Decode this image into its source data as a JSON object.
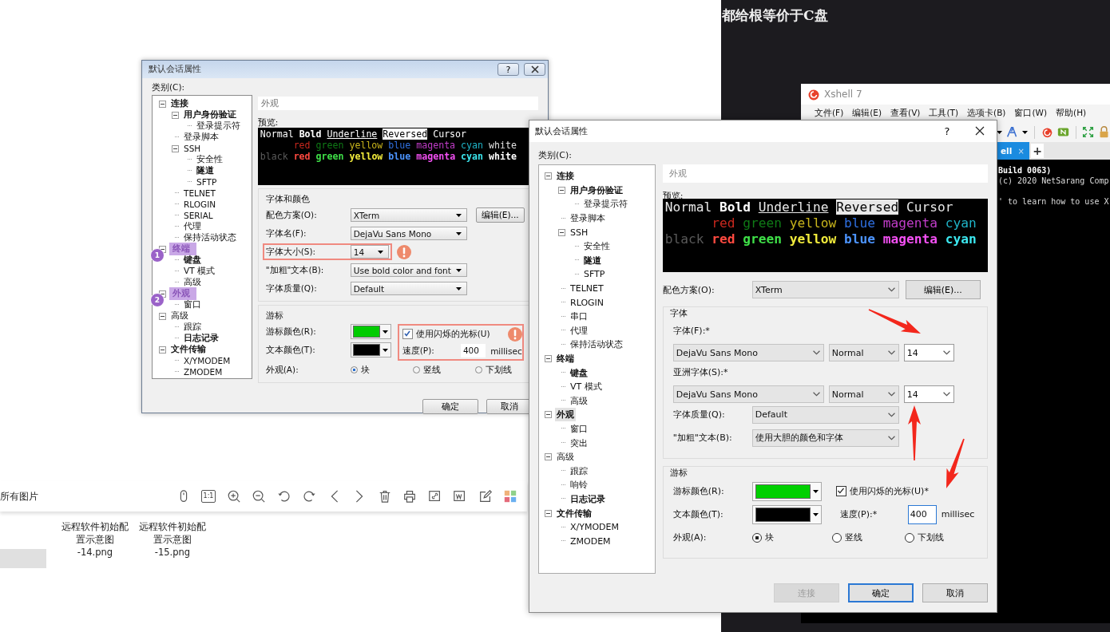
{
  "background": {
    "heading": "都给根等价于C盘"
  },
  "image_viewer": {
    "toolbar_label": "所有图片",
    "ratio_button": "1:1",
    "files": [
      {
        "name": "远程软件初始配置示意图",
        "suffix": "-14.png"
      },
      {
        "name": "远程软件初始配置示意图",
        "suffix": "-15.png"
      }
    ]
  },
  "old_dialog": {
    "title": "默认会话属性",
    "help": "?",
    "category_label": "类别(C):",
    "tree": [
      {
        "label": "连接",
        "bold": true,
        "expanded": true,
        "children": [
          {
            "label": "用户身份验证",
            "bold": true,
            "expanded": true,
            "children": [
              {
                "label": "登录提示符",
                "bold": false
              }
            ]
          },
          {
            "label": "登录脚本",
            "bold": false
          },
          {
            "label": "SSH",
            "bold": false,
            "expanded": true,
            "children": [
              {
                "label": "安全性",
                "bold": false
              },
              {
                "label": "隧道",
                "bold": true
              },
              {
                "label": "SFTP",
                "bold": false
              }
            ]
          },
          {
            "label": "TELNET",
            "bold": false
          },
          {
            "label": "RLOGIN",
            "bold": false
          },
          {
            "label": "SERIAL",
            "bold": false
          },
          {
            "label": "代理",
            "bold": false
          },
          {
            "label": "保持活动状态",
            "bold": false
          }
        ]
      },
      {
        "label": "终端",
        "bold": true,
        "badge": "1",
        "expanded": true,
        "children": [
          {
            "label": "键盘",
            "bold": true
          },
          {
            "label": "VT 模式",
            "bold": false
          },
          {
            "label": "高级",
            "bold": false
          }
        ]
      },
      {
        "label": "外观",
        "bold": true,
        "badge": "2",
        "expanded": true,
        "children": [
          {
            "label": "窗口",
            "bold": false
          }
        ]
      },
      {
        "label": "高级",
        "bold": false,
        "expanded": true,
        "children": [
          {
            "label": "跟踪",
            "bold": false
          },
          {
            "label": "日志记录",
            "bold": true
          }
        ]
      },
      {
        "label": "文件传输",
        "bold": true,
        "expanded": true,
        "children": [
          {
            "label": "X/YMODEM",
            "bold": false
          },
          {
            "label": "ZMODEM",
            "bold": false
          }
        ]
      }
    ],
    "page_title": "外观",
    "preview_label": "预览:",
    "preview": [
      {
        "indent": false,
        "segments": [
          {
            "text": "Normal",
            "kind": "normal",
            "color": "#ffffff"
          },
          {
            "text": "Bold",
            "kind": "bold",
            "color": "#ffffff"
          },
          {
            "text": "Underline",
            "kind": "underline",
            "color": "#ffffff"
          },
          {
            "text": "Reversed",
            "kind": "reversed",
            "color": "#ffffff"
          },
          {
            "text": "Cursor",
            "kind": "normal",
            "color": "#ffffff"
          }
        ]
      },
      {
        "indent": true,
        "segments": [
          {
            "text": "red",
            "kind": "normal",
            "color": "#c8281e"
          },
          {
            "text": "green",
            "kind": "normal",
            "color": "#0f7a16"
          },
          {
            "text": "yellow",
            "kind": "normal",
            "color": "#c9b51c"
          },
          {
            "text": "blue",
            "kind": "normal",
            "color": "#2f6fe0"
          },
          {
            "text": "magenta",
            "kind": "normal",
            "color": "#c03cc8"
          },
          {
            "text": "cyan",
            "kind": "normal",
            "color": "#1fb4c8"
          },
          {
            "text": "white",
            "kind": "normal",
            "color": "#e0e0e0"
          }
        ]
      },
      {
        "indent": false,
        "segments": [
          {
            "text": "black",
            "kind": "normal",
            "color": "#5a5a5a"
          },
          {
            "text": "red",
            "kind": "bold",
            "color": "#ff4a40"
          },
          {
            "text": "green",
            "kind": "bold",
            "color": "#3fe048"
          },
          {
            "text": "yellow",
            "kind": "bold",
            "color": "#f2ec3c"
          },
          {
            "text": "blue",
            "kind": "bold",
            "color": "#4c94ff"
          },
          {
            "text": "magenta",
            "kind": "bold",
            "color": "#f550f5"
          },
          {
            "text": "cyan",
            "kind": "bold",
            "color": "#3ce8f0"
          },
          {
            "text": "white",
            "kind": "bold",
            "color": "#ffffff"
          }
        ]
      }
    ],
    "font_group": {
      "title": "字体和颜色",
      "rows": [
        {
          "label": "配色方案(O):",
          "value": "XTerm",
          "button": "编辑(E)...",
          "highlighted": false
        },
        {
          "label": "字体名(F):",
          "value": "DejaVu Sans Mono",
          "highlighted": false
        },
        {
          "label": "字体大小(S):",
          "value": "14",
          "highlighted": true
        },
        {
          "label": "\"加粗\"文本(B):",
          "value": "Use bold color and font",
          "highlighted": false
        },
        {
          "label": "字体质量(Q):",
          "value": "Default",
          "highlighted": false
        }
      ]
    },
    "cursor_group": {
      "title": "游标",
      "cursor_color": {
        "label": "游标颜色(R):",
        "color": "#00cc00"
      },
      "text_color": {
        "label": "文本颜色(T):",
        "color": "#000000"
      },
      "blink": {
        "label": "使用闪烁的光标(U)",
        "checked": true,
        "highlighted": true
      },
      "speed": {
        "label": "速度(P):",
        "value": "400",
        "unit": "millisec"
      },
      "shape": {
        "label": "外观(A):",
        "options": [
          {
            "label": "块",
            "selected": true
          },
          {
            "label": "竖线",
            "selected": false
          },
          {
            "label": "下划线",
            "selected": false
          }
        ]
      }
    },
    "buttons": [
      {
        "label": "确定"
      },
      {
        "label": "取消"
      }
    ]
  },
  "xshell": {
    "title": "Xshell 7",
    "menu": [
      "文件(F)",
      "编辑(E)",
      "查看(V)",
      "工具(T)",
      "选项卡(B)",
      "窗口(W)",
      "帮助(H)"
    ],
    "tab": {
      "label": "ell",
      "close": "×",
      "selected": true
    },
    "new_tab": "+",
    "terminal_lines": [
      {
        "text": "Build 0063)",
        "bold": true
      },
      {
        "text": "(c) 2020 NetSarang Comp",
        "bold": false
      },
      {
        "text": "' to learn how to use X",
        "bold": false
      }
    ]
  },
  "new_dialog": {
    "title": "默认会话属性",
    "help": "?",
    "category_label": "类别(C):",
    "tree": [
      {
        "label": "连接",
        "bold": true,
        "selected": false,
        "expanded": true,
        "children": [
          {
            "label": "用户身份验证",
            "bold": true,
            "selected": false,
            "expanded": true,
            "children": [
              {
                "label": "登录提示符",
                "bold": false,
                "selected": false
              }
            ]
          },
          {
            "label": "登录脚本",
            "bold": false,
            "selected": false
          },
          {
            "label": "SSH",
            "bold": false,
            "selected": false,
            "expanded": true,
            "children": [
              {
                "label": "安全性",
                "bold": false,
                "selected": false
              },
              {
                "label": "隧道",
                "bold": true,
                "selected": false
              },
              {
                "label": "SFTP",
                "bold": false,
                "selected": false
              }
            ]
          },
          {
            "label": "TELNET",
            "bold": false,
            "selected": false
          },
          {
            "label": "RLOGIN",
            "bold": false,
            "selected": false
          },
          {
            "label": "串口",
            "bold": false,
            "selected": false
          },
          {
            "label": "代理",
            "bold": false,
            "selected": false
          },
          {
            "label": "保持活动状态",
            "bold": false,
            "selected": false
          }
        ]
      },
      {
        "label": "终端",
        "bold": true,
        "selected": false,
        "expanded": true,
        "children": [
          {
            "label": "键盘",
            "bold": true,
            "selected": false
          },
          {
            "label": "VT 模式",
            "bold": false,
            "selected": false
          },
          {
            "label": "高级",
            "bold": false,
            "selected": false
          }
        ]
      },
      {
        "label": "外观",
        "bold": true,
        "selected": true,
        "expanded": true,
        "children": [
          {
            "label": "窗口",
            "bold": false,
            "selected": false
          },
          {
            "label": "突出",
            "bold": false,
            "selected": false
          }
        ]
      },
      {
        "label": "高级",
        "bold": false,
        "selected": false,
        "expanded": true,
        "children": [
          {
            "label": "跟踪",
            "bold": false,
            "selected": false
          },
          {
            "label": "响铃",
            "bold": false,
            "selected": false
          },
          {
            "label": "日志记录",
            "bold": true,
            "selected": false
          }
        ]
      },
      {
        "label": "文件传输",
        "bold": true,
        "selected": false,
        "expanded": true,
        "children": [
          {
            "label": "X/YMODEM",
            "bold": false,
            "selected": false
          },
          {
            "label": "ZMODEM",
            "bold": false,
            "selected": false
          }
        ]
      }
    ],
    "page_title": "外观",
    "preview_label": "预览:",
    "preview": [
      {
        "indent": false,
        "segments": [
          {
            "text": "Normal",
            "kind": "normal",
            "color": "#e8e8e8"
          },
          {
            "text": "Bold",
            "kind": "bold",
            "color": "#ffffff"
          },
          {
            "text": "Underline",
            "kind": "underline",
            "color": "#e8e8e8"
          },
          {
            "text": "Reversed",
            "kind": "reversed",
            "color": "#e8e8e8"
          },
          {
            "text": "Cursor",
            "kind": "normal",
            "color": "#e8e8e8"
          }
        ]
      },
      {
        "indent": true,
        "segments": [
          {
            "text": "red",
            "kind": "normal",
            "color": "#c8281e"
          },
          {
            "text": "green",
            "kind": "normal",
            "color": "#0f7a16"
          },
          {
            "text": "yellow",
            "kind": "normal",
            "color": "#c9b51c"
          },
          {
            "text": "blue",
            "kind": "normal",
            "color": "#2f6fe0"
          },
          {
            "text": "magenta",
            "kind": "normal",
            "color": "#c03cc8"
          },
          {
            "text": "cyan",
            "kind": "normal",
            "color": "#1fb4c8"
          }
        ]
      },
      {
        "indent": false,
        "segments": [
          {
            "text": "black",
            "kind": "normal",
            "color": "#5a5a5a"
          },
          {
            "text": "red",
            "kind": "bold",
            "color": "#ff4a40"
          },
          {
            "text": "green",
            "kind": "bold",
            "color": "#3fe048"
          },
          {
            "text": "yellow",
            "kind": "bold",
            "color": "#f2ec3c"
          },
          {
            "text": "blue",
            "kind": "bold",
            "color": "#4c94ff"
          },
          {
            "text": "magenta",
            "kind": "bold",
            "color": "#f550f5"
          },
          {
            "text": "cyan",
            "kind": "bold",
            "color": "#3ce8f0"
          }
        ]
      }
    ],
    "scheme": {
      "label": "配色方案(O):",
      "value": "XTerm",
      "button": "编辑(E)..."
    },
    "font_group": {
      "title": "字体",
      "fonts": [
        {
          "label": "字体(F):*",
          "face": "DejaVu Sans Mono",
          "weight": "Normal",
          "size": "14"
        },
        {
          "label": "亚洲字体(S):*",
          "face": "DejaVu Sans Mono",
          "weight": "Normal",
          "size": "14"
        }
      ],
      "rows": [
        {
          "label": "字体质量(Q):",
          "value": "Default"
        },
        {
          "label": "\"加粗\"文本(B):",
          "value": "使用大胆的颜色和字体"
        }
      ]
    },
    "cursor_group": {
      "title": "游标",
      "cursor_color": {
        "label": "游标颜色(R):",
        "color": "#00d000"
      },
      "blink": {
        "label": "使用闪烁的光标(U)*",
        "checked": true
      },
      "text_color": {
        "label": "文本颜色(T):",
        "color": "#000000"
      },
      "speed": {
        "label": "速度(P):*",
        "value": "400",
        "unit": "millisec"
      },
      "shape": {
        "label": "外观(A):",
        "options": [
          {
            "label": "块",
            "selected": true
          },
          {
            "label": "竖线",
            "selected": false
          },
          {
            "label": "下划线",
            "selected": false
          }
        ]
      }
    },
    "buttons": [
      {
        "label": "连接",
        "disabled": true,
        "default": false
      },
      {
        "label": "确定",
        "disabled": false,
        "default": true
      },
      {
        "label": "取消",
        "disabled": false,
        "default": false
      }
    ]
  }
}
